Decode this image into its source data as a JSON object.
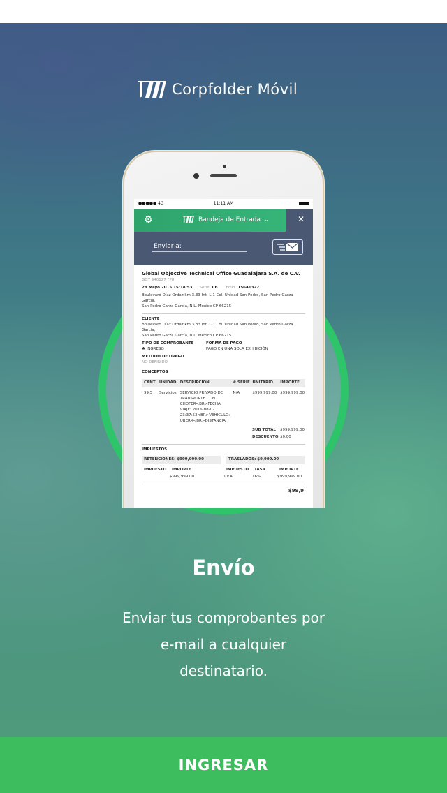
{
  "brand": {
    "name": "Corpfolder Móvil"
  },
  "phone": {
    "statusbar": {
      "carrier": "●●●●● 4G",
      "time": "11:11 AM"
    },
    "header": {
      "title": "Bandeja de Entrada",
      "settings_icon": "gear-icon",
      "close_icon": "close-icon",
      "dropdown_icon": "chevron-down-icon"
    },
    "send": {
      "label": "Enviar a:",
      "button_icon": "send-mail-icon"
    },
    "invoice": {
      "company": "Global Objective Technical Office Guadalajara S.A. de C.V.",
      "rfc": "GOT 940127 FP8",
      "date": "28 Mayo 2015 15:18:53",
      "serie_label": "Serie",
      "serie": "CB",
      "folio_label": "Folio",
      "folio": "15641322",
      "address_1": "Boulevard Díaz Ordaz km 3.33 Int. L-1 Col. Unidad San Pedro, San Pedro Garza García,",
      "address_2": "San Pedro Garza García, N.L. México CP 66215",
      "cliente_label": "CLIENTE",
      "cliente_address_1": "Boulevard Díaz Ordaz km 3.33 Int. L-1 Col. Unidad San Pedro, San Pedro Garza García,",
      "cliente_address_2": "San Pedro Garza García, N.L. México CP 66215",
      "tipo_label": "TIPO DE COMPROBANTE",
      "tipo_value": "♣ INGRESO",
      "forma_label": "FORMA DE PAGO",
      "forma_value": "PAGO EN UNA SOLA EXHIBICIÓN",
      "metodo_label": "MÉTODO DE OPAGO",
      "metodo_value": "NO DEFINIDO",
      "conceptos_label": "CONCEPTOS",
      "columns": [
        "CANT.",
        "UNIDAD",
        "DESCRIPCIÓN",
        "# SERIE",
        "UNITARIO",
        "IMPORTE"
      ],
      "row": {
        "cant": "99.5",
        "unidad": "Servicios",
        "desc_1": "SERVICIO PRIVADO DE",
        "desc_2": "TRANSPORTE CON",
        "desc_3": "CHOFER<BR>FECHA",
        "desc_4": "VIAJE: 2016-08-02",
        "desc_5": "23:37:53<BR>VEHICULO:",
        "desc_6": "UBERX<BR>DISTANCIA:",
        "serie": "N/A",
        "unitario": "$999,999.00",
        "importe": "$999,999.00"
      },
      "subtotal_label": "SUB TOTAL",
      "subtotal": "$999,999.00",
      "descuento_label": "DESCUENTO",
      "descuento": "$0.00",
      "impuestos_label": "IMPUESTOS",
      "retenciones": "RETENCIONES: $999,999.00",
      "traslados": "TRASLADOS: $9,999.00",
      "ret_cols": [
        "IMPUESTO",
        "IMPORTE"
      ],
      "tra_cols": [
        "IMPUESTO",
        "TASA",
        "IMPORTE"
      ],
      "ret_importe": "$999,999.00",
      "tra_impuesto": "I.V.A.",
      "tra_tasa": "16%",
      "tra_importe": "$999,999.00",
      "total_partial": "$99,9"
    }
  },
  "feature": {
    "title": "Envío",
    "line_1": "Enviar tus comprobantes por",
    "line_2": "e-mail a cualquier",
    "line_3": "destinatario."
  },
  "cta": {
    "label": "INGRESAR"
  },
  "colors": {
    "accent": "#3ebd5f",
    "ring": "#2ec46a",
    "header_blue": "#4a5874"
  }
}
